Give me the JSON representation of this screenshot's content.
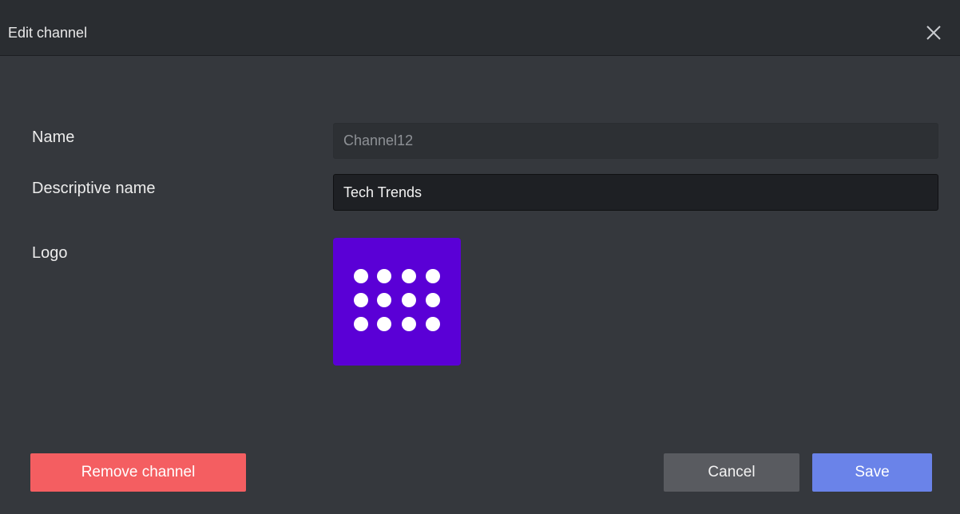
{
  "dialog": {
    "title": "Edit channel",
    "close_icon": "close-icon"
  },
  "form": {
    "name_label": "Name",
    "name_value": "Channel12",
    "descriptive_label": "Descriptive name",
    "descriptive_value": "Tech Trends",
    "logo_label": "Logo",
    "logo_icon": "dot-grid-icon",
    "logo_color": "#5a00d6"
  },
  "actions": {
    "remove_label": "Remove channel",
    "cancel_label": "Cancel",
    "save_label": "Save",
    "remove_color": "#f45e61",
    "save_color": "#6a83e9"
  }
}
